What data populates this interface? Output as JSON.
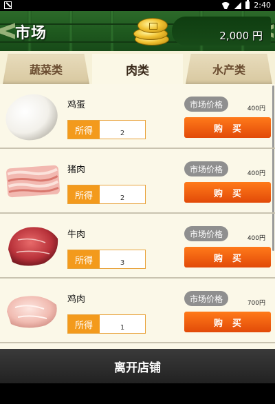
{
  "status_bar": {
    "time": "2:40"
  },
  "header": {
    "title": "市场",
    "money": "2,000 円"
  },
  "tabs": [
    {
      "label": "蔬菜类",
      "active": false
    },
    {
      "label": "肉类",
      "active": true
    },
    {
      "label": "水产类",
      "active": false
    }
  ],
  "items": [
    {
      "name": "鸡蛋",
      "got_label": "所得",
      "got": "2",
      "price_label": "市场价格",
      "price": "400円",
      "buy_label": "购买",
      "icon": "egg-icon"
    },
    {
      "name": "猪肉",
      "got_label": "所得",
      "got": "2",
      "price_label": "市场价格",
      "price": "400円",
      "buy_label": "购买",
      "icon": "bacon-icon"
    },
    {
      "name": "牛肉",
      "got_label": "所得",
      "got": "3",
      "price_label": "市场价格",
      "price": "400円",
      "buy_label": "购买",
      "icon": "beef-icon"
    },
    {
      "name": "鸡肉",
      "got_label": "所得",
      "got": "1",
      "price_label": "市场价格",
      "price": "700円",
      "buy_label": "购买",
      "icon": "chicken-icon"
    }
  ],
  "leave_button": "离开店铺",
  "colors": {
    "header": "#1f5a1f",
    "buy": "#e8560c",
    "got_label": "#f39a1c",
    "price_tag": "#8f8f8f"
  }
}
